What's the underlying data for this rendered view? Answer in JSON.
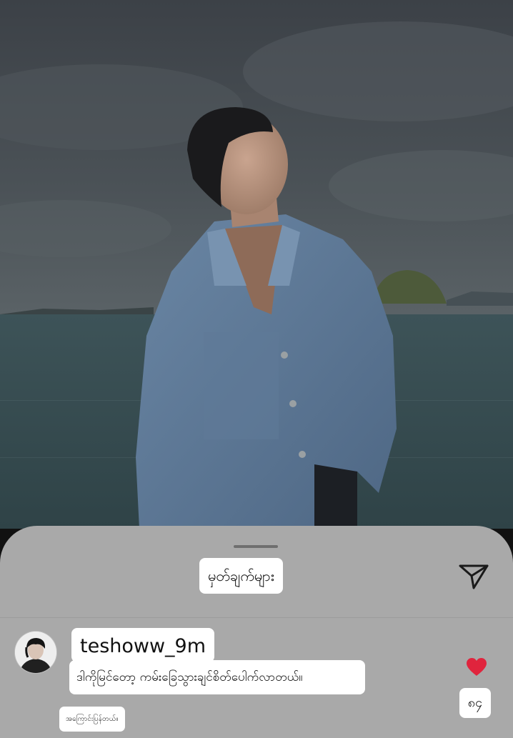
{
  "photo": {
    "alt_subject": "photo-background"
  },
  "comments_sheet": {
    "title": "မှတ်ချက်များ",
    "share_icon": "send-icon"
  },
  "comment": {
    "username": "teshoww_9m",
    "text": "ဒါကိုမြင်တော့ ကမ်းခြေသွားချင်စိတ်ပေါက်လာတယ်။",
    "reply_label": "အကြောင်းပြန်တယ်။",
    "like_icon": "heart-icon",
    "like_count": "၈၄",
    "like_color": "#e0243d"
  }
}
